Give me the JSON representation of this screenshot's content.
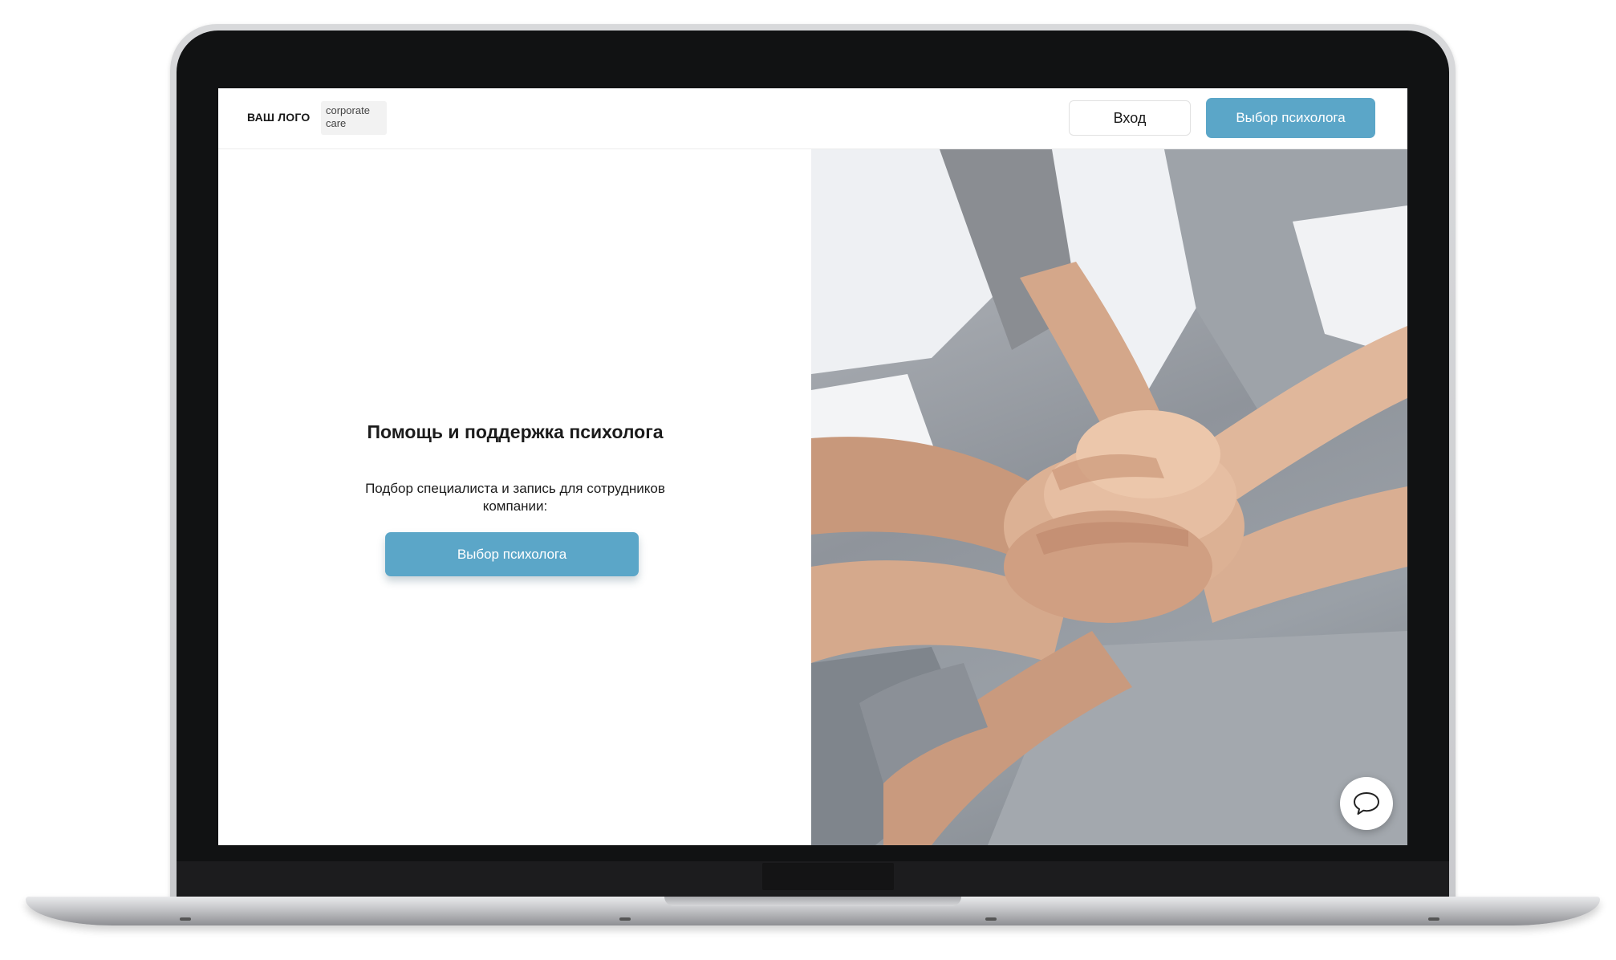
{
  "header": {
    "logo_text": "ВАШ ЛОГО",
    "brand_badge": {
      "line1": "corporate",
      "line2": "care"
    },
    "login_label": "Вход",
    "choose_psychologist_label": "Выбор психолога"
  },
  "hero": {
    "title": "Помощь и поддержка психолога",
    "subtitle": "Подбор специалиста и запись для сотрудников компании:",
    "cta_label": "Выбор психолога",
    "image_icon": "team-hands-photo"
  },
  "chat": {
    "icon": "chat-bubble-icon"
  },
  "colors": {
    "accent": "#5ba6c8",
    "text": "#1b1b1b",
    "bezel": "#111213",
    "background": "#ffffff"
  }
}
